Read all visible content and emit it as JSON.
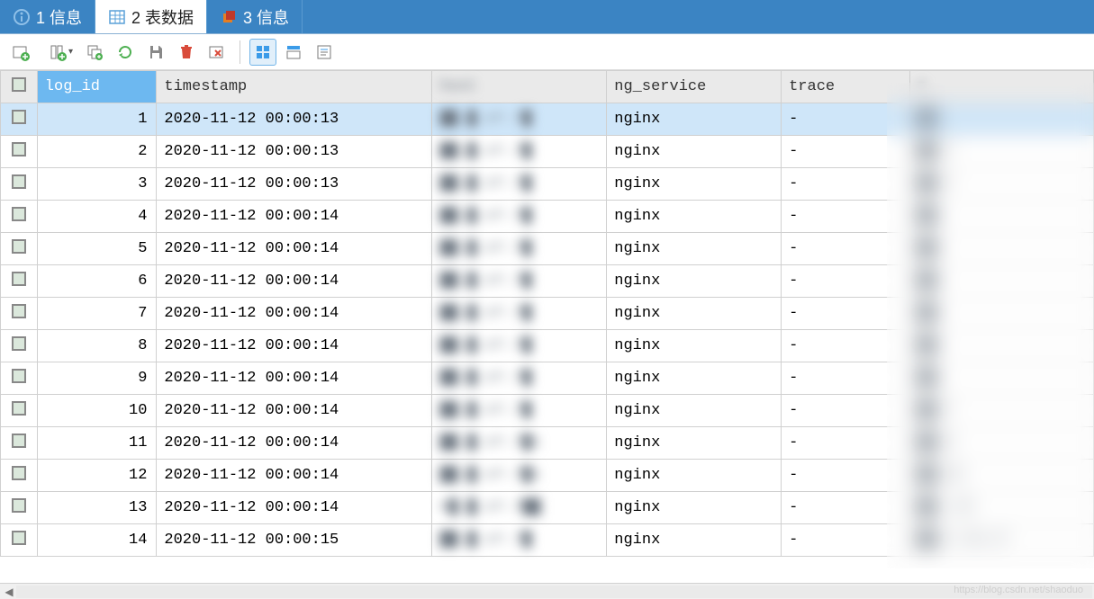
{
  "tabs": [
    {
      "label": "1 信息",
      "icon": "info-circle",
      "active": false
    },
    {
      "label": "2 表数据",
      "icon": "table-grid",
      "active": true
    },
    {
      "label": "3 信息",
      "icon": "cube",
      "active": false
    }
  ],
  "toolbar": {
    "icons": [
      "add-row-icon",
      "add-col-dropdown-icon",
      "duplicate-icon",
      "refresh-icon",
      "save-icon",
      "delete-icon",
      "undo-icon",
      "view-grid-icon",
      "view-form-icon",
      "view-text-icon"
    ]
  },
  "columns": {
    "checkbox": "",
    "log_id": "log_id",
    "timestamp": "timestamp",
    "host": "host",
    "ng_service": "ng_service",
    "trace": "trace",
    "col6": "c"
  },
  "rows": [
    {
      "log_id": "1",
      "timestamp": "2020-11-12 00:00:13",
      "host": "██.█.17.7█",
      "ng_service": "nginx",
      "trace": "-",
      "col6": "",
      "selected": true
    },
    {
      "log_id": "2",
      "timestamp": "2020-11-12 00:00:13",
      "host": "██.█.17.7█",
      "ng_service": "nginx",
      "trace": "-",
      "col6": "7"
    },
    {
      "log_id": "3",
      "timestamp": "2020-11-12 00:00:13",
      "host": "██.█.17.7█",
      "ng_service": "nginx",
      "trace": "-",
      "col6": "7"
    },
    {
      "log_id": "4",
      "timestamp": "2020-11-12 00:00:14",
      "host": "██.█.17.7█",
      "ng_service": "nginx",
      "trace": "-",
      "col6": ""
    },
    {
      "log_id": "5",
      "timestamp": "2020-11-12 00:00:14",
      "host": "██.█.17.7█",
      "ng_service": "nginx",
      "trace": "-",
      "col6": ""
    },
    {
      "log_id": "6",
      "timestamp": "2020-11-12 00:00:14",
      "host": "██.█.17.7█",
      "ng_service": "nginx",
      "trace": "-",
      "col6": ""
    },
    {
      "log_id": "7",
      "timestamp": "2020-11-12 00:00:14",
      "host": "██.█.17.7█",
      "ng_service": "nginx",
      "trace": "-",
      "col6": ""
    },
    {
      "log_id": "8",
      "timestamp": "2020-11-12 00:00:14",
      "host": "██.█.17.7█",
      "ng_service": "nginx",
      "trace": "-",
      "col6": ""
    },
    {
      "log_id": "9",
      "timestamp": "2020-11-12 00:00:14",
      "host": "██.█.17.7█",
      "ng_service": "nginx",
      "trace": "-",
      "col6": ""
    },
    {
      "log_id": "10",
      "timestamp": "2020-11-12 00:00:14",
      "host": "██.█.17.7█",
      "ng_service": "nginx",
      "trace": "-",
      "col6": "7"
    },
    {
      "log_id": "11",
      "timestamp": "2020-11-12 00:00:14",
      "host": "██.█.17.7█1",
      "ng_service": "nginx",
      "trace": "-",
      "col6": "6"
    },
    {
      "log_id": "12",
      "timestamp": "2020-11-12 00:00:14",
      "host": "██.█.17.7█1",
      "ng_service": "nginx",
      "trace": "-",
      "col6": "26"
    },
    {
      "log_id": "13",
      "timestamp": "2020-11-12 00:00:14",
      "host": "8█.█.17.7██",
      "ng_service": "nginx",
      "trace": "-",
      "col6": ".38"
    },
    {
      "log_id": "14",
      "timestamp": "2020-11-12 00:00:15",
      "host": "██.█.17.7█",
      "ng_service": "nginx",
      "trace": "-",
      "col6": "3 30.27"
    }
  ],
  "watermark": "https://blog.csdn.net/shaoduo"
}
